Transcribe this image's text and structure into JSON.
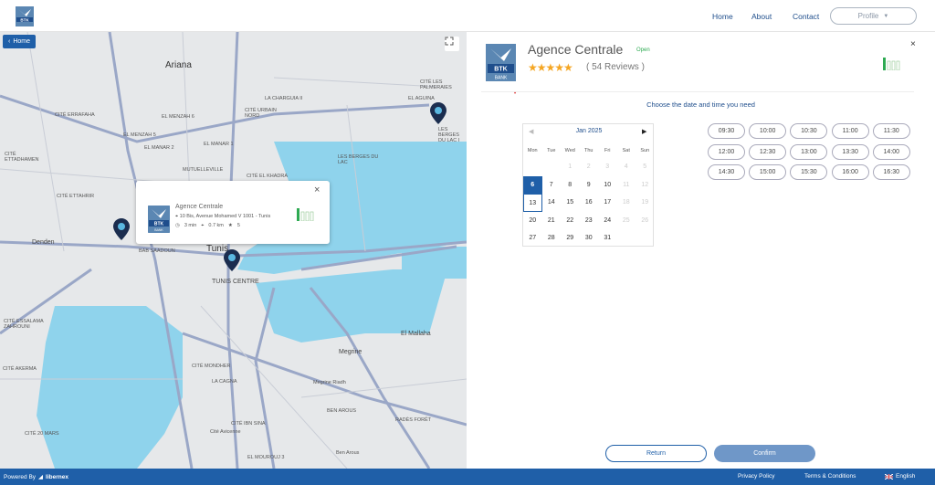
{
  "header": {
    "logo_text": "BTK",
    "nav": [
      "Home",
      "About",
      "Contact"
    ],
    "profile_label": "Profile"
  },
  "map": {
    "home_label": "Home",
    "labels_big": [
      "Ariana",
      "Tunis"
    ],
    "labels": [
      "CITÉ ERRAFAHA",
      "EL MENZAH 6",
      "EL MENZAH 5",
      "CITÉ URBAIN NORD",
      "EL MANAR 2",
      "MUTUELLEVILLE",
      "CITÉ EL KHADRA",
      "CITÉ ETTAHRIR",
      "BAB SAADOUN",
      "TUNIS CENTRE",
      "CITÉ ESSALAMA ZAHROUNI",
      "CITÉ AKERMA",
      "CITÉ MONDHER",
      "LA CAGNA",
      "CITÉ IBN SINA",
      "CITÉ 20 MARS",
      "Cité Avicenne",
      "EL MOUROUJ 3",
      "Ben Arous",
      "Megrine",
      "Megrine Riadh",
      "BEN AROUS",
      "El Mallaha",
      "RADÈS FORÊT",
      "LES BERGES DU LAC",
      "LES BERGES DU LAC I",
      "CITÉ LES PALMERAIES",
      "EL AGUINA",
      "Denden",
      "CITÉ ETTADHAMEN",
      "LA CHARGUIA II",
      "EL MANAR 1"
    ],
    "popup": {
      "name": "Agence Centrale",
      "address": "10 Bis, Avenue Mohamed V 1001 - Tunis",
      "time": "3 min",
      "distance": "0.7 km",
      "rating": "5",
      "close": "×"
    }
  },
  "agency": {
    "name": "Agence Centrale",
    "status": "Open",
    "stars": "★★★★★",
    "reviews": "( 54 Reviews )",
    "close": "×",
    "logo_text": "BTK",
    "logo_sub": "BANK"
  },
  "booking": {
    "prompt": "Choose the date and time you need",
    "calendar": {
      "month": "Jan 2025",
      "prev": "◀",
      "next": "▶",
      "weekdays": [
        "Mon",
        "Tue",
        "Wed",
        "Thu",
        "Fri",
        "Sat",
        "Sun"
      ],
      "weeks": [
        [
          "",
          "",
          "1",
          "2",
          "3",
          "4",
          "5"
        ],
        [
          "6",
          "7",
          "8",
          "9",
          "10",
          "11",
          "12"
        ],
        [
          "13",
          "14",
          "15",
          "16",
          "17",
          "18",
          "19"
        ],
        [
          "20",
          "21",
          "22",
          "23",
          "24",
          "25",
          "26"
        ],
        [
          "27",
          "28",
          "29",
          "30",
          "31",
          "",
          ""
        ]
      ],
      "selected": "6",
      "today": "13"
    },
    "time_slots": [
      "09:30",
      "10:00",
      "10:30",
      "11:00",
      "11:30",
      "12:00",
      "12:30",
      "13:00",
      "13:30",
      "14:00",
      "14:30",
      "15:00",
      "15:30",
      "16:00",
      "16:30"
    ],
    "return_label": "Return",
    "confirm_label": "Confirm"
  },
  "footer": {
    "powered": "Powered By",
    "brand": "libernex",
    "privacy": "Privacy Policy",
    "terms": "Terms & Conditions",
    "language": "English"
  },
  "colors": {
    "primary": "#1f5fa8",
    "open": "#2eaa52",
    "star": "#f5a623",
    "water": "#8fd3ec"
  }
}
